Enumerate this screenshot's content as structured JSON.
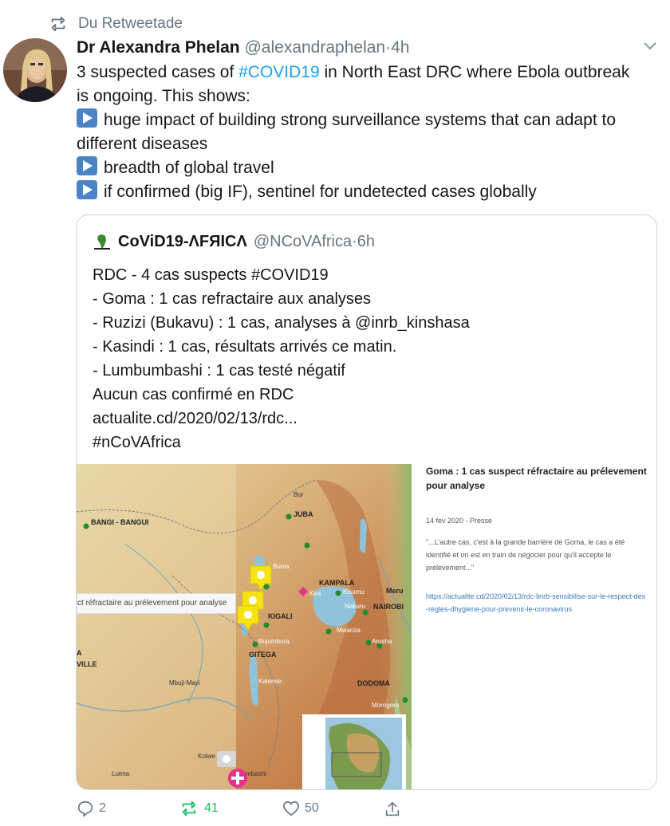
{
  "retweet_context": {
    "label": "Du Retweetade"
  },
  "tweet": {
    "author_name": "Dr Alexandra Phelan",
    "author_handle": "@alexandraphelan",
    "separator": "·",
    "time": "4h",
    "text_lines": {
      "l1_pre": "3 suspected cases of ",
      "l1_tag": "#COVID19",
      "l1_post": " in North East DRC where Ebola outbreak",
      "l2": "is ongoing. This shows:",
      "l3": "huge impact of building strong surveillance systems that can adapt to",
      "l4": "different diseases",
      "l5": "breadth of global travel",
      "l6": "if confirmed (big IF), sentinel for undetected cases globally"
    }
  },
  "quoted_tweet": {
    "author_name": "CoViD19-ΛFЯICΛ",
    "author_handle": "@NCoVAfrica",
    "separator": "·",
    "time": "6h",
    "lines": [
      "RDC - 4 cas suspects #COVID19",
      "- Goma : 1 cas refractaire aux analyses",
      "- Ruzizi (Bukavu) : 1 cas, analyses à @inrb_kinshasa",
      "- Kasindi : 1 cas, résultats arrivés ce matin.",
      "- Lumbumbashi : 1 cas testé négatif",
      "Aucun cas confirmé en RDC",
      "actualite.cd/2020/02/13/rdc...",
      "#nCoVAfrica"
    ]
  },
  "media": {
    "popup_text": "ct réfractaire au prélevement pour analyse",
    "panel": {
      "title": "Goma : 1 cas suspect réfractaire au prélevement pour analyse",
      "date": "14 fev 2020 - Presse",
      "quote": "\"...L'autre cas, c'est à la grande barrière de Goma, le cas a été identifié et on est en train de négocier pour qu'il accepte le prélèvement...\"",
      "link": "https://actualite.cd/2020/02/13/rdc-linrb-sensibilise-sur-le-respect-des-regles-dhygiene-pour-prevenir-le-coronavirus"
    },
    "map_labels": {
      "bor": "Bor",
      "juba": "JUBA",
      "bangi": "BANGI - BANGUI",
      "bunia": "Bunia",
      "kampala": "KAMPALA",
      "kira": "Kira",
      "kisumu": "Kisumu",
      "meru": "Meru",
      "nakuru": "Nakuru",
      "nairobi": "NAIROBI",
      "kigali": "KIGALI",
      "mwanza": "Mwanza",
      "arusha": "Arusha",
      "bujumbura": "Bujumbura",
      "gitega": "GITEGA",
      "a": "A",
      "ville": "VILLE",
      "mbuji": "Mbuji-Mayi",
      "kalemie": "Kalemie",
      "dodoma": "DODOMA",
      "morogoro": "Morogoro",
      "kolwe": "Kolwe",
      "mbashi": "mbashi",
      "luena": "Luena"
    }
  },
  "actions": {
    "reply_count": "2",
    "retweet_count": "41",
    "like_count": "50"
  },
  "colors": {
    "accent": "#1da1f2",
    "retweet_green": "#17bf63",
    "muted": "#657786",
    "marker_yellow": "#f5e313",
    "marker_pink": "#e8318c"
  }
}
